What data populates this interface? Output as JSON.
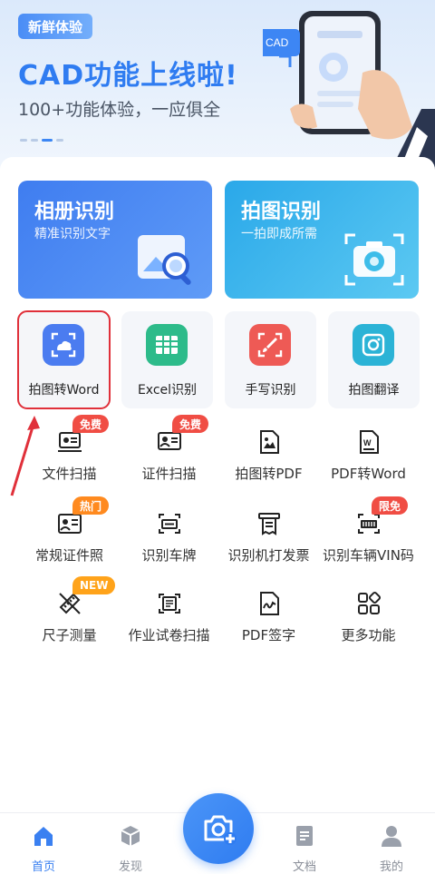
{
  "banner": {
    "badge": "新鲜体验",
    "title": "CAD功能上线啦!",
    "subtitle": "100+功能体验，一应俱全",
    "phone_badge": "CAD"
  },
  "feature_cards": [
    {
      "title": "相册识别",
      "subtitle": "精准识别文字"
    },
    {
      "title": "拍图识别",
      "subtitle": "一拍即成所需"
    }
  ],
  "tiles": [
    {
      "label": "拍图转Word",
      "icon": "cloud-image-icon",
      "color": "#4b7cf0"
    },
    {
      "label": "Excel识别",
      "icon": "table-icon",
      "color": "#2dbb8a"
    },
    {
      "label": "手写识别",
      "icon": "brush-icon",
      "color": "#ee5a55"
    },
    {
      "label": "拍图翻译",
      "icon": "camera-icon",
      "color": "#2bb3d6"
    }
  ],
  "grid": [
    {
      "label": "文件扫描",
      "tag": "免费"
    },
    {
      "label": "证件扫描",
      "tag": "免费"
    },
    {
      "label": "拍图转PDF",
      "tag": ""
    },
    {
      "label": "PDF转Word",
      "tag": ""
    },
    {
      "label": "常规证件照",
      "tag": "热门"
    },
    {
      "label": "识别车牌",
      "tag": ""
    },
    {
      "label": "识别机打发票",
      "tag": ""
    },
    {
      "label": "识别车辆VIN码",
      "tag": "限免"
    },
    {
      "label": "尺子测量",
      "tag": "NEW"
    },
    {
      "label": "作业试卷扫描",
      "tag": ""
    },
    {
      "label": "PDF签字",
      "tag": ""
    },
    {
      "label": "更多功能",
      "tag": ""
    }
  ],
  "nav": {
    "home": "首页",
    "discover": "发现",
    "docs": "文档",
    "mine": "我的"
  },
  "colors": {
    "accent": "#2f7cf1",
    "selection": "#e0303a"
  }
}
